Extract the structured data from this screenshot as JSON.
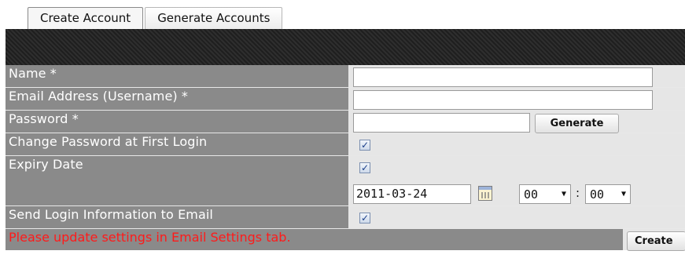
{
  "tabs": [
    {
      "label": "Create Account",
      "active": true
    },
    {
      "label": "Generate Accounts",
      "active": false
    }
  ],
  "form": {
    "name": {
      "label": "Name *",
      "value": ""
    },
    "email": {
      "label": "Email Address (Username) *",
      "value": ""
    },
    "password": {
      "label": "Password *",
      "value": "",
      "generate_label": "Generate"
    },
    "change_password": {
      "label": "Change Password at First Login",
      "checked": true,
      "mark": "✓"
    },
    "expiry": {
      "label": "Expiry Date",
      "checked": true,
      "mark": "✓",
      "date": "2011-03-24",
      "hour": "00",
      "minute": "00",
      "separator": ":"
    },
    "send_login": {
      "label": "Send Login Information to Email",
      "checked": true,
      "mark": "✓"
    }
  },
  "message": "Please update settings in Email Settings tab.",
  "create_label": "Create",
  "colors": {
    "label_bg": "#8a8a8a",
    "value_bg": "#e6e6e6",
    "warning": "#ff1a1a"
  },
  "icons": {
    "calendar": "calendar-icon",
    "dropdown": "chevron-down-icon"
  }
}
